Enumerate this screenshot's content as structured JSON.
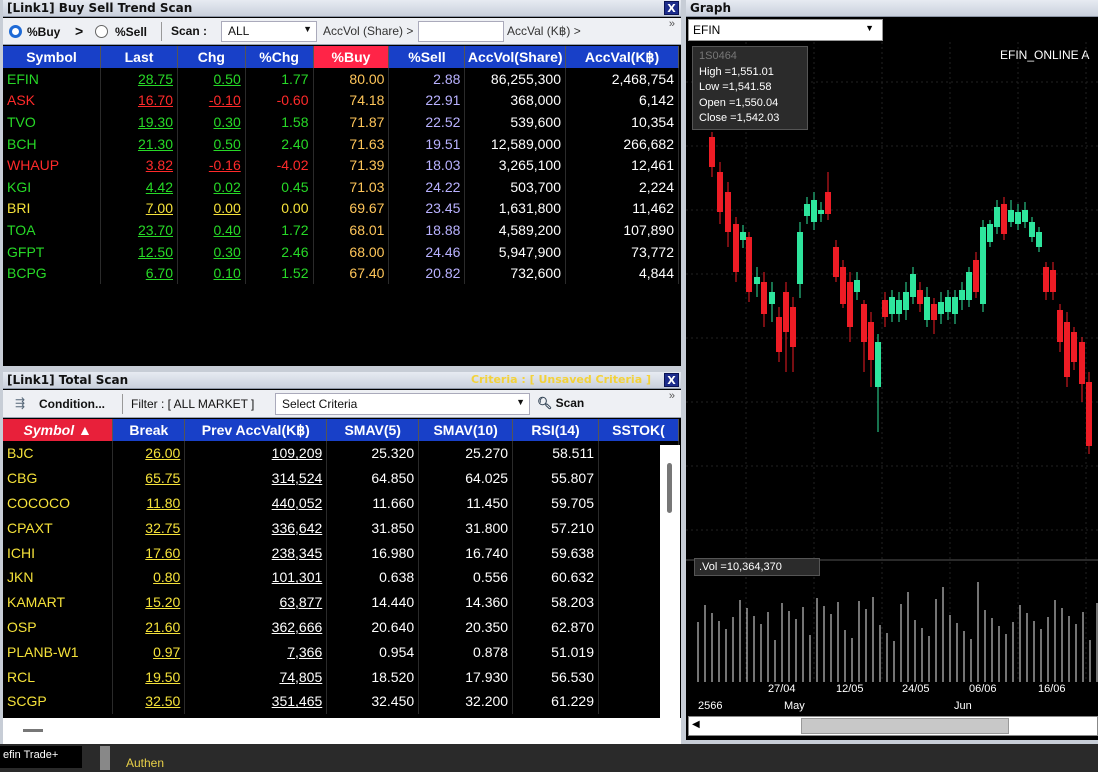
{
  "bst": {
    "title": "[Link1] Buy Sell Trend Scan",
    "close": "X",
    "opt_buy": "%Buy",
    ">": ">",
    "opt_sell": "%Sell",
    "scan_label": "Scan :",
    "scan_value": "ALL",
    "accvol_label": "AccVol (Share) >",
    "accval_label": "AccVal (K฿) >",
    "more": "»",
    "columns": [
      "Symbol",
      "Last",
      "Chg",
      "%Chg",
      "%Buy",
      "%Sell",
      "AccVol(Share)",
      "AccVal(K฿)"
    ],
    "rows": [
      [
        "EFIN",
        "28.75",
        "0.50",
        "1.77",
        "80.00",
        "2.88",
        "86,255,300",
        "2,468,754",
        "g"
      ],
      [
        "ASK",
        "16.70",
        "-0.10",
        "-0.60",
        "74.18",
        "22.91",
        "368,000",
        "6,142",
        "r"
      ],
      [
        "TVO",
        "19.30",
        "0.30",
        "1.58",
        "71.87",
        "22.52",
        "539,600",
        "10,354",
        "g"
      ],
      [
        "BCH",
        "21.30",
        "0.50",
        "2.40",
        "71.63",
        "19.51",
        "12,589,000",
        "266,682",
        "g"
      ],
      [
        "WHAUP",
        "3.82",
        "-0.16",
        "-4.02",
        "71.39",
        "18.03",
        "3,265,100",
        "12,461",
        "r"
      ],
      [
        "KGI",
        "4.42",
        "0.02",
        "0.45",
        "71.03",
        "24.22",
        "503,700",
        "2,224",
        "g"
      ],
      [
        "BRI",
        "7.00",
        "0.00",
        "0.00",
        "69.67",
        "23.45",
        "1,631,800",
        "11,462",
        "y"
      ],
      [
        "TOA",
        "23.70",
        "0.40",
        "1.72",
        "68.01",
        "18.88",
        "4,589,200",
        "107,890",
        "g"
      ],
      [
        "GFPT",
        "12.50",
        "0.30",
        "2.46",
        "68.00",
        "24.46",
        "5,947,900",
        "73,772",
        "g"
      ],
      [
        "BCPG",
        "6.70",
        "0.10",
        "1.52",
        "67.40",
        "20.82",
        "732,600",
        "4,844",
        "g"
      ]
    ]
  },
  "ts": {
    "title": "[Link1] Total Scan",
    "criteria": "Criteria : [ Unsaved Criteria ]",
    "close": "X",
    "condition": "Condition...",
    "filter": "Filter : [ ALL MARKET ]",
    "select": "Select Criteria",
    "scan": "Scan",
    "more": "»",
    "columns": [
      "Symbol",
      "Break",
      "Prev AccVal(K฿)",
      "SMAV(5)",
      "SMAV(10)",
      "RSI(14)",
      "SSTOK("
    ],
    "rows": [
      [
        "BJC",
        "26.00",
        "109,209",
        "25.320",
        "25.270",
        "58.511"
      ],
      [
        "CBG",
        "65.75",
        "314,524",
        "64.850",
        "64.025",
        "55.807"
      ],
      [
        "COCOCO",
        "11.80",
        "440,052",
        "11.660",
        "11.450",
        "59.705"
      ],
      [
        "CPAXT",
        "32.75",
        "336,642",
        "31.850",
        "31.800",
        "57.210"
      ],
      [
        "ICHI",
        "17.60",
        "238,345",
        "16.980",
        "16.740",
        "59.638"
      ],
      [
        "JKN",
        "0.80",
        "101,301",
        "0.638",
        "0.556",
        "60.632"
      ],
      [
        "KAMART",
        "15.20",
        "63,877",
        "14.440",
        "14.360",
        "58.203"
      ],
      [
        "OSP",
        "21.60",
        "362,666",
        "20.640",
        "20.350",
        "62.870"
      ],
      [
        "PLANB-W1",
        "0.97",
        "7,366",
        "0.954",
        "0.878",
        "51.019"
      ],
      [
        "RCL",
        "19.50",
        "74,805",
        "18.520",
        "17.930",
        "56.530"
      ],
      [
        "SCGP",
        "32.50",
        "351,465",
        "32.450",
        "32.200",
        "61.229"
      ]
    ]
  },
  "graph": {
    "title": "Graph",
    "symbol": "EFIN",
    "chart_label": "EFIN_ONLINE A",
    "tooltip_sym": "1S0464",
    "high": "High  =1,551.01",
    "low": "Low   =1,541.58",
    "open": "Open  =1,550.04",
    "close": "Close  =1,542.03",
    "vol": ".Vol  =10,364,370",
    "xticks": [
      "27/04",
      "12/05",
      "24/05",
      "06/06",
      "16/06"
    ],
    "year": "2566",
    "months": [
      "May",
      "Jun"
    ]
  },
  "taskbar": {
    "app": "efin Trade+",
    "status": "Authen"
  },
  "colors": {
    "up": "#2ee59d",
    "down": "#ee1c25",
    "accent": "#1840c8"
  }
}
